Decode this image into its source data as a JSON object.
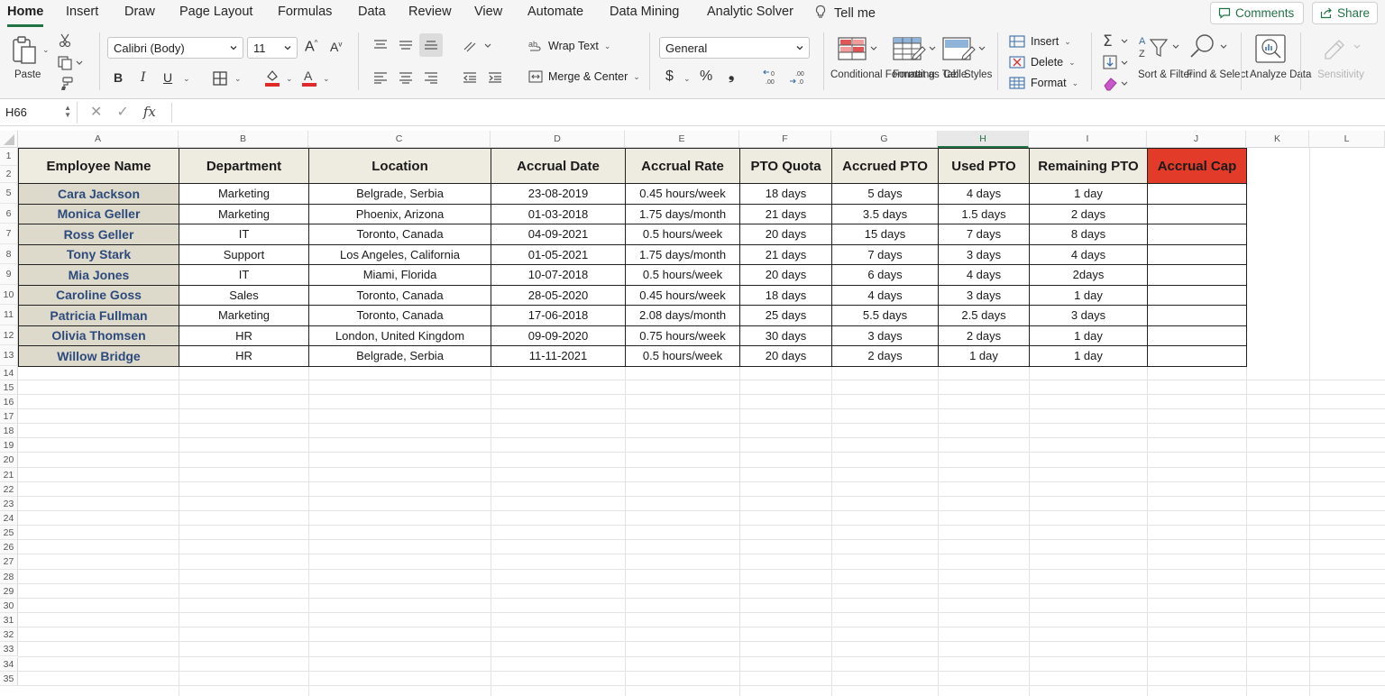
{
  "menu": {
    "tabs": [
      "Home",
      "Insert",
      "Draw",
      "Page Layout",
      "Formulas",
      "Data",
      "Review",
      "View",
      "Automate",
      "Data Mining",
      "Analytic Solver"
    ],
    "tell_me": "Tell me",
    "comments": "Comments",
    "share": "Share"
  },
  "ribbon": {
    "paste": "Paste",
    "font_name": "Calibri (Body)",
    "font_size": "11",
    "wrap_text": "Wrap Text",
    "merge_center": "Merge & Center",
    "number_format": "General",
    "currency": "$",
    "percent": "%",
    "comma": "❟",
    "conditional_formatting": "Conditional Formatting",
    "format_as_table": "Format as Table",
    "cell_styles": "Cell Styles",
    "insert": "Insert",
    "delete": "Delete",
    "format": "Format",
    "sort_filter": "Sort & Filter",
    "find_select": "Find & Select",
    "analyze_data": "Analyze Data",
    "sensitivity": "Sensitivity"
  },
  "formula_bar": {
    "name_box": "H66",
    "formula": ""
  },
  "sheet": {
    "columns": [
      "A",
      "B",
      "C",
      "D",
      "E",
      "F",
      "G",
      "H",
      "I",
      "J",
      "K",
      "L"
    ],
    "selected_column": "H",
    "row_numbers": [
      "1",
      "2",
      "5",
      "6",
      "7",
      "8",
      "9",
      "10",
      "11",
      "12",
      "13",
      "14",
      "15",
      "16",
      "17",
      "18",
      "19",
      "20",
      "21",
      "22",
      "23",
      "24",
      "25",
      "26",
      "27",
      "28",
      "29",
      "30",
      "31",
      "32",
      "33",
      "34",
      "35"
    ],
    "headers": [
      "Employee Name",
      "Department",
      "Location",
      "Accrual Date",
      "Accrual Rate",
      "PTO Quota",
      "Accrued PTO",
      "Used PTO",
      "Remaining PTO",
      "Accrual Cap"
    ],
    "rows": [
      [
        "Cara Jackson",
        "Marketing",
        "Belgrade, Serbia",
        "23-08-2019",
        "0.45 hours/week",
        "18 days",
        "5 days",
        "4 days",
        "1 day",
        ""
      ],
      [
        "Monica Geller",
        "Marketing",
        "Phoenix, Arizona",
        "01-03-2018",
        "1.75 days/month",
        "21 days",
        "3.5 days",
        "1.5 days",
        "2 days",
        ""
      ],
      [
        "Ross Geller",
        "IT",
        "Toronto, Canada",
        "04-09-2021",
        "0.5 hours/week",
        "20 days",
        "15 days",
        "7 days",
        "8 days",
        ""
      ],
      [
        "Tony Stark",
        "Support",
        "Los Angeles, California",
        "01-05-2021",
        "1.75 days/month",
        "21 days",
        "7 days",
        "3 days",
        "4 days",
        ""
      ],
      [
        "Mia Jones",
        "IT",
        "Miami, Florida",
        "10-07-2018",
        "0.5 hours/week",
        "20 days",
        "6 days",
        "4 days",
        "2days",
        ""
      ],
      [
        "Caroline Goss",
        "Sales",
        "Toronto, Canada",
        "28-05-2020",
        "0.45 hours/week",
        "18 days",
        "4 days",
        "3 days",
        "1 day",
        ""
      ],
      [
        "Patricia Fullman",
        "Marketing",
        "Toronto, Canada",
        "17-06-2018",
        "2.08 days/month",
        "25 days",
        "5.5 days",
        "2.5 days",
        "3 days",
        ""
      ],
      [
        "Olivia Thomsen",
        "HR",
        "London, United Kingdom",
        "09-09-2020",
        "0.75 hours/week",
        "30 days",
        "3 days",
        "2 days",
        "1 day",
        ""
      ],
      [
        "Willow Bridge",
        "HR",
        "Belgrade, Serbia",
        "11-11-2021",
        "0.5 hours/week",
        "20 days",
        "2 days",
        "1 day",
        "1 day",
        ""
      ]
    ]
  },
  "colors": {
    "accent": "#217346",
    "header_fill": "#eeebe0",
    "name_fill": "#dedacb",
    "name_text": "#2d4a7c",
    "cap_fill": "#e33b2a"
  }
}
